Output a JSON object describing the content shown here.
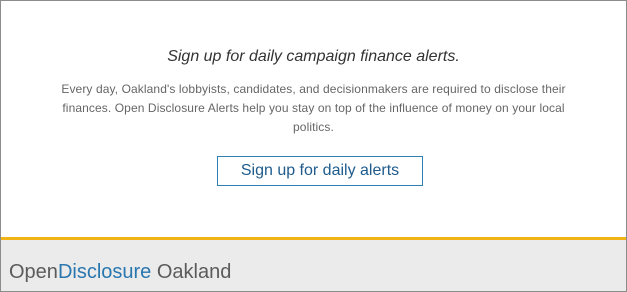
{
  "signup": {
    "heading": "Sign up for daily campaign finance alerts.",
    "body": "Every day, Oakland's lobbyists, candidates, and decisionmakers are required to disclose their finances. Open Disclosure Alerts help you stay on top of the influence of money on your local politics.",
    "button_label": "Sign up for daily alerts"
  },
  "brand": {
    "part_open": "Open",
    "part_disclosure": "Disclosure",
    "part_city": " Oakland"
  },
  "colors": {
    "accent_gold": "#f2b317",
    "link_blue": "#2a77b0",
    "footer_bg": "#ebebeb"
  }
}
